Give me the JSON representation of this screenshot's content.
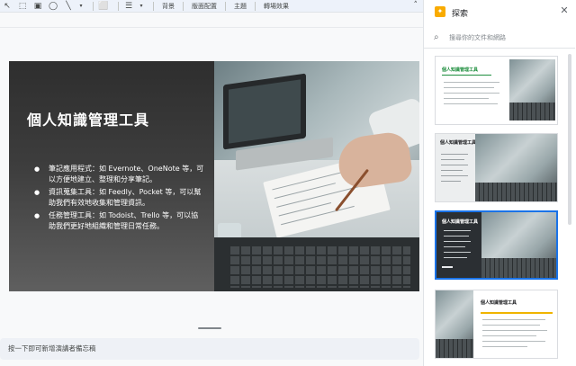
{
  "toolbar": {
    "items": [
      "背景",
      "版面配置",
      "主題",
      "轉場效果"
    ]
  },
  "slide": {
    "title": "個人知識管理工具",
    "bullets": [
      "筆記應用程式：如 Evernote、OneNote 等，可以方便地建立、整理和分享筆記。",
      "資訊蒐集工具：如 Feedly、Pocket 等，可以幫助我們有效地收集和管理資訊。",
      "任務管理工具：如 Todoist、Trello 等，可以協助我們更好地組織和管理日常任務。"
    ]
  },
  "notes": {
    "placeholder": "按一下即可新增演講者備忘稿"
  },
  "explore": {
    "title": "探索",
    "search_placeholder": "搜尋你的文件和網路",
    "thumbnails": [
      {
        "title": "個人知識管理工具"
      },
      {
        "title": "個人知識管理工具"
      },
      {
        "title": "個人知識管理工具"
      },
      {
        "title": "個人知識管理工具"
      }
    ]
  },
  "colors": {
    "accent": "#1a73e8",
    "explore_icon": "#f9ab00",
    "thumb1_title": "#1e8e3e",
    "thumb3_bg": "#2b2f33",
    "thumb4_accent": "#f0b400"
  }
}
